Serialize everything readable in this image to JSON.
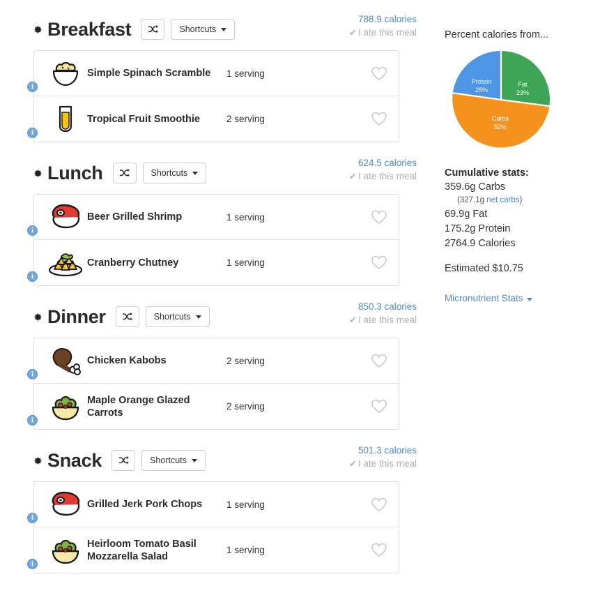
{
  "meals": [
    {
      "name": "Breakfast",
      "gear_icon": "gear-icon",
      "shuffle_icon": "shuffle-icon",
      "shortcuts_label": "Shortcuts",
      "calories": "788.9 calories",
      "ate_label": "I ate this meal",
      "ate_check": "✔",
      "items": [
        {
          "name": "Simple Spinach Scramble",
          "serving": "1 serving",
          "icon": "bowl-eggs-icon",
          "info": "i",
          "heart": "heart-outline-icon"
        },
        {
          "name": "Tropical Fruit Smoothie",
          "serving": "2 serving",
          "icon": "smoothie-glass-icon",
          "info": "i",
          "heart": "heart-outline-icon"
        }
      ]
    },
    {
      "name": "Lunch",
      "gear_icon": "gear-icon",
      "shuffle_icon": "shuffle-icon",
      "shortcuts_label": "Shortcuts",
      "calories": "624.5 calories",
      "ate_label": "I ate this meal",
      "ate_check": "✔",
      "items": [
        {
          "name": "Beer Grilled Shrimp",
          "serving": "1 serving",
          "icon": "steak-icon",
          "info": "i",
          "heart": "heart-outline-icon"
        },
        {
          "name": "Cranberry Chutney",
          "serving": "1 serving",
          "icon": "nachos-plate-icon",
          "info": "i",
          "heart": "heart-outline-icon"
        }
      ]
    },
    {
      "name": "Dinner",
      "gear_icon": "gear-icon",
      "shuffle_icon": "shuffle-icon",
      "shortcuts_label": "Shortcuts",
      "calories": "850.3 calories",
      "ate_label": "I ate this meal",
      "ate_check": "✔",
      "items": [
        {
          "name": "Chicken Kabobs",
          "serving": "2 serving",
          "icon": "drumstick-icon",
          "info": "i",
          "heart": "heart-outline-icon"
        },
        {
          "name": "Maple Orange Glazed Carrots",
          "serving": "2 serving",
          "icon": "salad-bowl-icon",
          "info": "i",
          "heart": "heart-outline-icon"
        }
      ]
    },
    {
      "name": "Snack",
      "gear_icon": "gear-icon",
      "shuffle_icon": "shuffle-icon",
      "shortcuts_label": "Shortcuts",
      "calories": "501.3 calories",
      "ate_label": "I ate this meal",
      "ate_check": "✔",
      "items": [
        {
          "name": "Grilled Jerk Pork Chops",
          "serving": "1 serving",
          "icon": "steak-icon",
          "info": "i",
          "heart": "heart-outline-icon"
        },
        {
          "name": "Heirloom Tomato Basil Mozzarella Salad",
          "serving": "1 serving",
          "icon": "salad-bowl-icon",
          "info": "i",
          "heart": "heart-outline-icon"
        }
      ]
    }
  ],
  "stats": {
    "chart_title": "Percent calories from...",
    "cumulative_header": "Cumulative stats:",
    "carbs": "359.6g Carbs",
    "net_carbs_prefix": "(327.1g ",
    "net_carbs_link": "net carbs",
    "net_carbs_suffix": ")",
    "fat": "69.9g Fat",
    "protein": "175.2g Protein",
    "calories": "2764.9 Calories",
    "estimated_cost": "Estimated $10.75",
    "micronutrient_link": "Micronutrient Stats"
  },
  "chart_data": {
    "type": "pie",
    "title": "Percent calories from...",
    "labels": [
      "Fat",
      "Carbs",
      "Protein"
    ],
    "values": [
      23,
      52,
      25
    ],
    "value_suffix": "%",
    "colors": [
      "#3FA556",
      "#F5921E",
      "#4E95E5"
    ],
    "slice_labels": [
      {
        "name": "Fat",
        "value": "23%"
      },
      {
        "name": "Carbs",
        "value": "52%"
      },
      {
        "name": "Protein",
        "value": "25%"
      }
    ],
    "start_angle_deg": 0,
    "direction": "clockwise",
    "legend": "none"
  },
  "colors": {
    "link_blue": "#4a8bd6",
    "fat_green": "#3FA556",
    "carbs_orange": "#F5921E",
    "protein_blue": "#4E95E5",
    "muted_gray": "#b0b0b0"
  }
}
